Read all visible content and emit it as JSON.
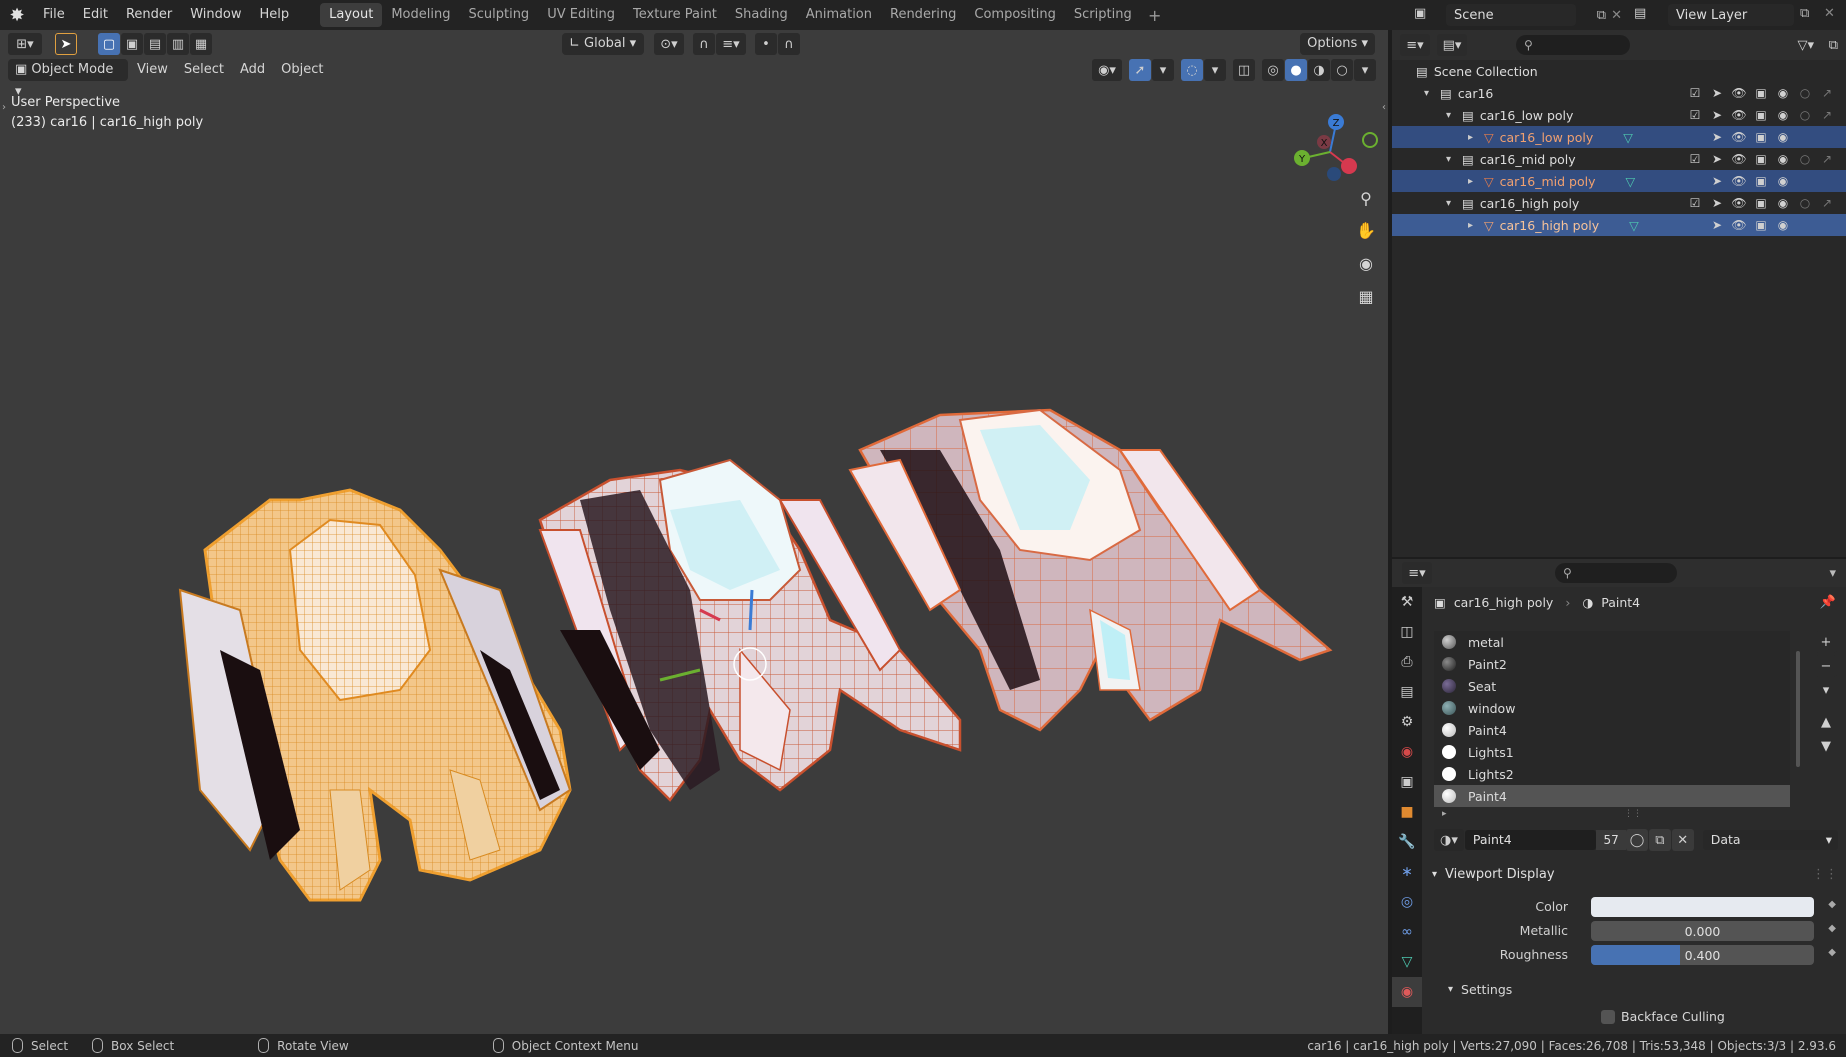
{
  "menubar": {
    "items": [
      "File",
      "Edit",
      "Render",
      "Window",
      "Help"
    ],
    "workspaces": [
      "Layout",
      "Modeling",
      "Sculpting",
      "UV Editing",
      "Texture Paint",
      "Shading",
      "Animation",
      "Rendering",
      "Compositing",
      "Scripting"
    ],
    "active_workspace": "Layout",
    "scene": "Scene",
    "view_layer": "View Layer"
  },
  "viewport": {
    "transform_orientation": "Global",
    "options_label": "Options",
    "mode": "Object Mode",
    "menus": [
      "View",
      "Select",
      "Add",
      "Object"
    ],
    "perspective_label": "User Perspective",
    "object_info": "(233) car16 | car16_high poly",
    "gizmo": {
      "x": "X",
      "y": "Y",
      "z": "Z"
    }
  },
  "outliner": {
    "rows": [
      {
        "label": "Scene Collection",
        "type": "scene"
      },
      {
        "label": "car16",
        "type": "collection"
      },
      {
        "label": "car16_low poly",
        "type": "collection"
      },
      {
        "label": "car16_low poly",
        "type": "mesh"
      },
      {
        "label": "car16_mid poly",
        "type": "collection"
      },
      {
        "label": "car16_mid poly",
        "type": "mesh"
      },
      {
        "label": "car16_high poly",
        "type": "collection"
      },
      {
        "label": "car16_high poly",
        "type": "mesh"
      }
    ]
  },
  "properties": {
    "breadcrumb_object": "car16_high poly",
    "breadcrumb_material": "Paint4",
    "slots": [
      {
        "name": "metal",
        "color": "#8a8a8a"
      },
      {
        "name": "Paint2",
        "color": "#4a4a4a"
      },
      {
        "name": "Seat",
        "color": "#3a3448"
      },
      {
        "name": "window",
        "color": "#4f6e72"
      },
      {
        "name": "Paint4",
        "color": "#f2f2f2"
      },
      {
        "name": "Lights1",
        "color": "#ffffff"
      },
      {
        "name": "Lights2",
        "color": "#ffffff"
      },
      {
        "name": "Paint4",
        "color": "#f2f2f2"
      }
    ],
    "active_slot": 7,
    "material_name": "Paint4",
    "user_count": "57",
    "link": "Data",
    "panel_viewport_display": "Viewport Display",
    "color_label": "Color",
    "metallic_label": "Metallic",
    "metallic_value": "0.000",
    "roughness_label": "Roughness",
    "roughness_value": "0.400",
    "roughness_fraction": 0.4,
    "settings_label": "Settings",
    "backface_label": "Backface Culling"
  },
  "statusbar": {
    "select": "Select",
    "box_select": "Box Select",
    "rotate": "Rotate View",
    "context": "Object Context Menu",
    "stats": "car16 | car16_high poly | Verts:27,090 | Faces:26,708 | Tris:53,348 | Objects:3/3 | 2.93.6"
  },
  "colors": {
    "selection": "#334d80",
    "active_blue": "#4772b3",
    "orange": "#e87d4a",
    "car_orange": "#f0a030"
  }
}
